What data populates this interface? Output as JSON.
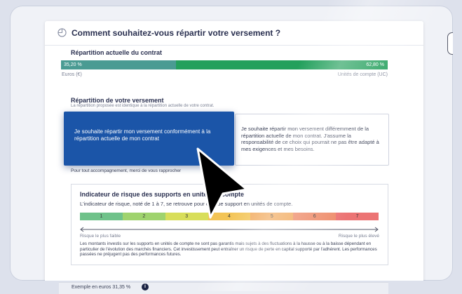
{
  "header": {
    "title": "Comment souhaitez-vous répartir votre versement ?",
    "icon": "pie-chart-icon"
  },
  "current_allocation": {
    "title": "Répartition actuelle du contrat",
    "euro_percent": "35,20 %",
    "uc_percent": "62,80 %",
    "euro_label": "Euros (€)",
    "uc_label": "Unités de compte (UC)",
    "colors": {
      "euro": "#4a9b93",
      "uc": "#23a05c"
    }
  },
  "payment_allocation": {
    "title": "Répartition de votre versement",
    "subtitle": "La répartition proposée est identique à la répartition actuelle de votre contrat.",
    "option_same": "Je souhaite répartir mon versement conformément à la répartition actuelle de mon contrat",
    "option_different": "Je souhaite répartir mon versement différemment de la répartition actuelle de mon contrat. J'assume la responsabilité de ce choix qui pourrait ne pas être adapté à mes exigences et mes besoins.",
    "support_note": "Pour tout accompagnement, merci de vous rapprocher",
    "selected_color": "#1b55a8"
  },
  "risk": {
    "title": "Indicateur de risque des supports en unités de compte",
    "subtitle": "L'indicateur de risque, noté de 1 à 7, se retrouve pour chaque support en unités de compte.",
    "levels": [
      "1",
      "2",
      "3",
      "4",
      "5",
      "6",
      "7"
    ],
    "level_colors": [
      "#6fc28a",
      "#9fd36e",
      "#d8de5a",
      "#f3c456",
      "#f1a85a",
      "#ee8c6a",
      "#ec7474"
    ],
    "low_label": "Risque le plus faible",
    "high_label": "Risque le plus élevé",
    "disclaimer": "Les montants investis sur les supports en unités de compte ne sont pas garantis mais sujets à des fluctuations à la hausse ou à la baisse dépendant en particulier de l'évolution des marchés financiers. Cet investissement peut entraîner un risque de perte en capital supporté par l'adhérent. Les performances passées ne préjugent pas des performances futures."
  },
  "bottom": {
    "label": "Exemple en euros 31,35 %",
    "info_icon": "info-icon",
    "info_glyph": "i"
  }
}
